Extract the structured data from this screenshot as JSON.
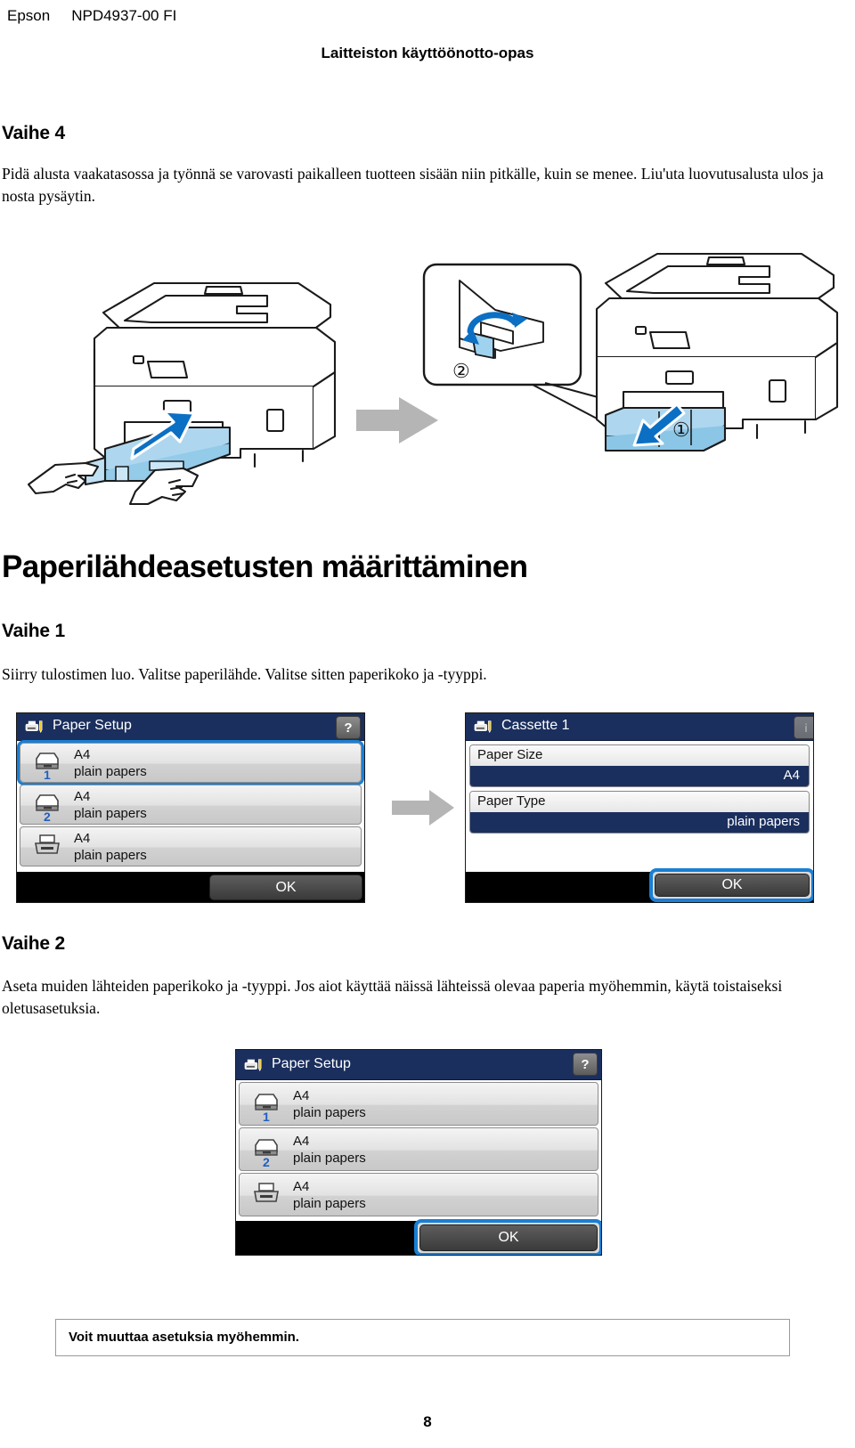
{
  "header": {
    "brand": "Epson",
    "doc_number": "NPD4937-00 FI",
    "title": "Laitteiston käyttöönotto-opas"
  },
  "step4": {
    "heading": "Vaihe 4",
    "body": "Pidä alusta vaakatasossa ja työnnä se varovasti paikalleen tuotteen sisään niin pitkälle, kuin se menee. Liu'uta luovutusalusta ulos ja nosta pysäytin."
  },
  "illustration": {
    "callout_1": "①",
    "callout_2": "②",
    "arrow_icon": "gray-right-arrow",
    "left_icon": "printer-insert-cassette",
    "right_icon": "printer-output-tray"
  },
  "section": {
    "title": "Paperilähdeasetusten määrittäminen"
  },
  "step1": {
    "heading": "Vaihe 1",
    "body": "Siirry tulostimen luo. Valitse paperilähde. Valitse sitten paperikoko ja -tyyppi."
  },
  "step2": {
    "heading": "Vaihe 2",
    "body": "Aseta muiden lähteiden paperikoko ja -tyyppi. Jos aiot käyttää näissä lähteissä olevaa paperia myöhemmin, käytä toistaiseksi oletusasetuksia."
  },
  "lcd_paper_setup_1": {
    "title": "Paper Setup",
    "help_label": "?",
    "rows": [
      {
        "num": "1",
        "size": "A4",
        "type": "plain papers",
        "icon": "cassette-icon",
        "selected": true
      },
      {
        "num": "2",
        "size": "A4",
        "type": "plain papers",
        "icon": "cassette-icon",
        "selected": false
      },
      {
        "num": "",
        "size": "A4",
        "type": "plain papers",
        "icon": "rear-feed-icon",
        "selected": false
      }
    ],
    "ok_label": "OK",
    "ok_highlighted": false
  },
  "lcd_cassette_1": {
    "title": "Cassette 1",
    "help_label": "i",
    "settings": [
      {
        "label": "Paper Size",
        "value": "A4"
      },
      {
        "label": "Paper Type",
        "value": "plain papers"
      }
    ],
    "ok_label": "OK",
    "ok_highlighted": true
  },
  "lcd_paper_setup_2": {
    "title": "Paper Setup",
    "help_label": "?",
    "rows": [
      {
        "num": "1",
        "size": "A4",
        "type": "plain papers",
        "icon": "cassette-icon",
        "selected": false
      },
      {
        "num": "2",
        "size": "A4",
        "type": "plain papers",
        "icon": "cassette-icon",
        "selected": false
      },
      {
        "num": "",
        "size": "A4",
        "type": "plain papers",
        "icon": "rear-feed-icon",
        "selected": false
      }
    ],
    "ok_label": "OK",
    "ok_highlighted": true
  },
  "note": {
    "text": "Voit muuttaa asetuksia myöhemmin."
  },
  "footer": {
    "page_number": "8"
  },
  "colors": {
    "lcd_navy": "#1b2f5e",
    "selection_blue": "#1a7fd4",
    "illustration_blue": "#0b6fc4",
    "gray_arrow": "#b5b5b5"
  }
}
